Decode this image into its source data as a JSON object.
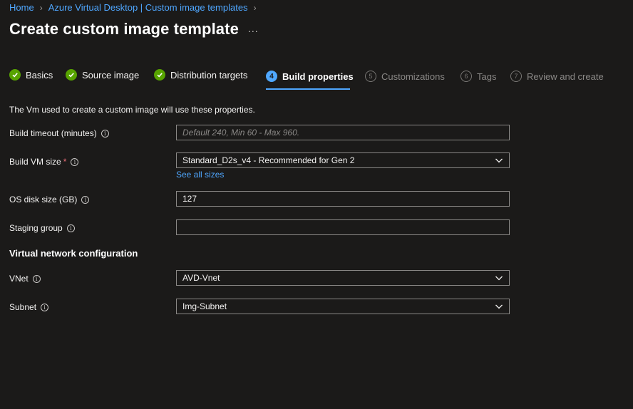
{
  "breadcrumb": {
    "items": [
      "Home",
      "Azure Virtual Desktop | Custom image templates"
    ]
  },
  "page": {
    "title": "Create custom image template",
    "more_label": "..."
  },
  "steps": [
    {
      "label": "Basics",
      "state": "completed"
    },
    {
      "label": "Source image",
      "state": "completed"
    },
    {
      "label": "Distribution targets",
      "state": "completed"
    },
    {
      "label": "Build properties",
      "number": "4",
      "state": "current"
    },
    {
      "label": "Customizations",
      "number": "5",
      "state": "pending"
    },
    {
      "label": "Tags",
      "number": "6",
      "state": "pending"
    },
    {
      "label": "Review and create",
      "number": "7",
      "state": "pending"
    }
  ],
  "intro": "The Vm used to create a custom image will use these properties.",
  "form": {
    "build_timeout": {
      "label": "Build timeout (minutes)",
      "placeholder": "Default 240, Min 60 - Max 960.",
      "value": ""
    },
    "build_vm_size": {
      "label": "Build VM size",
      "required_mark": "*",
      "value": "Standard_D2s_v4 - Recommended for Gen 2",
      "link": "See all sizes"
    },
    "os_disk_size": {
      "label": "OS disk size (GB)",
      "value": "127"
    },
    "staging_group": {
      "label": "Staging group",
      "value": ""
    }
  },
  "network": {
    "heading": "Virtual network configuration",
    "vnet": {
      "label": "VNet",
      "value": "AVD-Vnet"
    },
    "subnet": {
      "label": "Subnet",
      "value": "Img-Subnet"
    }
  },
  "icons": {
    "check": "check-icon",
    "info": "info-icon",
    "chevron": "chevron-down-icon"
  },
  "colors": {
    "accent": "#4fa7ff",
    "success": "#57a300",
    "required": "#f1707b",
    "background": "#1b1a19"
  }
}
